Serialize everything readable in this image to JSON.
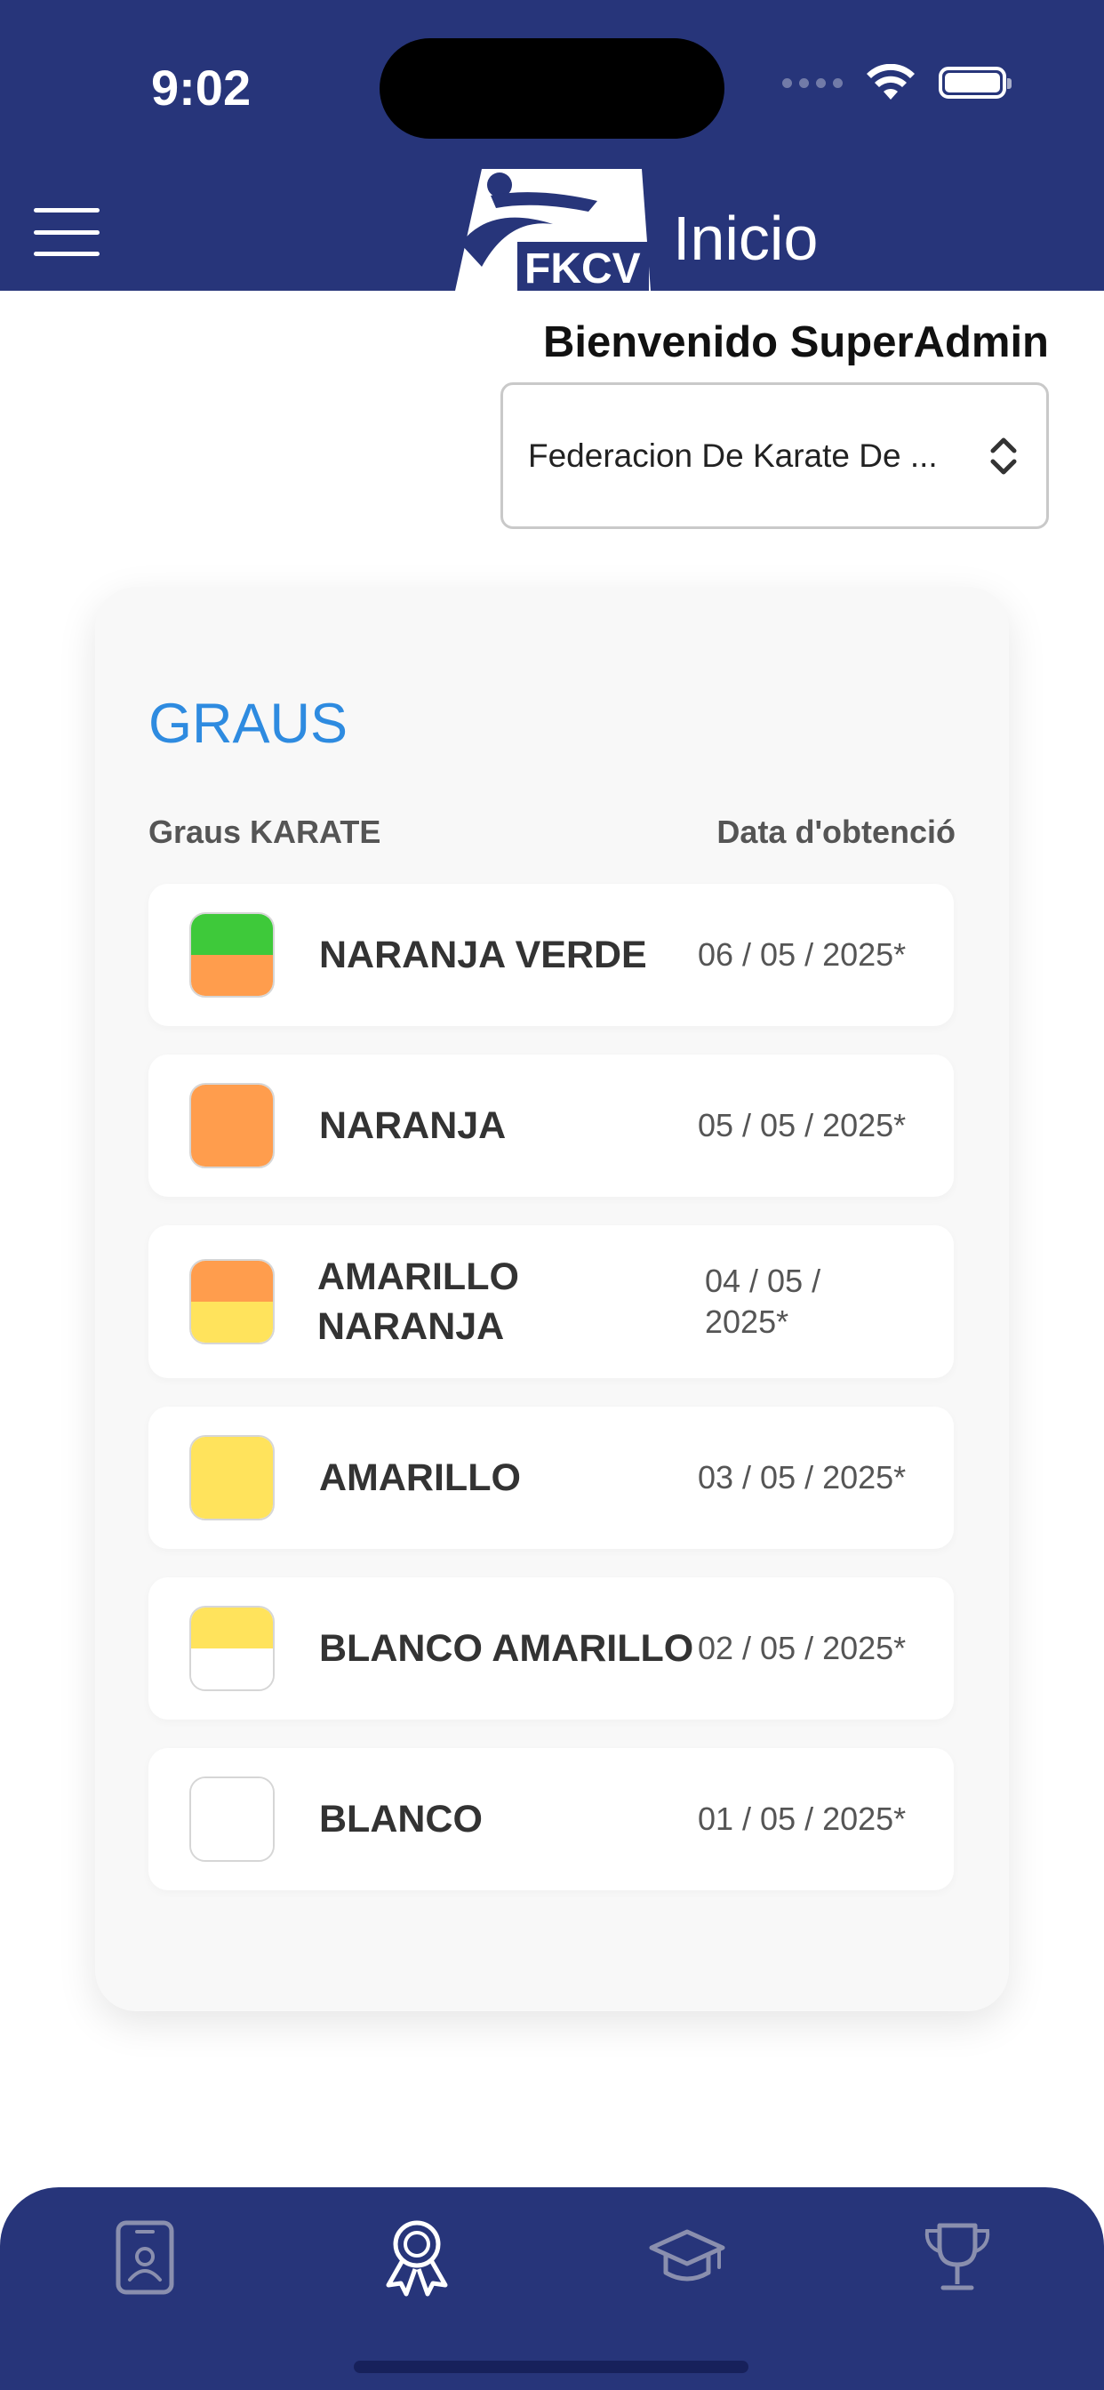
{
  "status_bar": {
    "time": "9:02"
  },
  "header": {
    "logo_text": "FKCV",
    "title": "Inicio"
  },
  "welcome": {
    "text": "Bienvenido SuperAdmin"
  },
  "federation_select": {
    "value": "Federacion De Karate De ..."
  },
  "grades_card": {
    "title": "GRAUS",
    "col_grade": "Graus KARATE",
    "col_date": "Data d'obtenció",
    "rows": [
      {
        "name": "NARANJA VERDE",
        "date": "06 / 05 / 2025*",
        "top_color": "#3ec93a",
        "bottom_color": "#ff9d4d"
      },
      {
        "name": "NARANJA",
        "date": "05 / 05 / 2025*",
        "top_color": "#ff9d4d",
        "bottom_color": "#ff9d4d"
      },
      {
        "name": "AMARILLO NARANJA",
        "date": "04 / 05 / 2025*",
        "top_color": "#ff9d4d",
        "bottom_color": "#ffe35c"
      },
      {
        "name": "AMARILLO",
        "date": "03 / 05 / 2025*",
        "top_color": "#ffe35c",
        "bottom_color": "#ffe35c"
      },
      {
        "name": "BLANCO AMARILLO",
        "date": "02 / 05 / 2025*",
        "top_color": "#ffe35c",
        "bottom_color": "#ffffff"
      },
      {
        "name": "BLANCO",
        "date": "01 / 05 / 2025*",
        "top_color": "#ffffff",
        "bottom_color": "#ffffff"
      }
    ]
  },
  "tabbar": {
    "tabs": [
      {
        "icon": "id-card-icon",
        "active": false
      },
      {
        "icon": "award-ribbon-icon",
        "active": true
      },
      {
        "icon": "graduation-cap-icon",
        "active": false
      },
      {
        "icon": "trophy-icon",
        "active": false
      }
    ]
  },
  "colors": {
    "brand_navy": "#27357a",
    "accent_blue": "#2e8be0"
  }
}
